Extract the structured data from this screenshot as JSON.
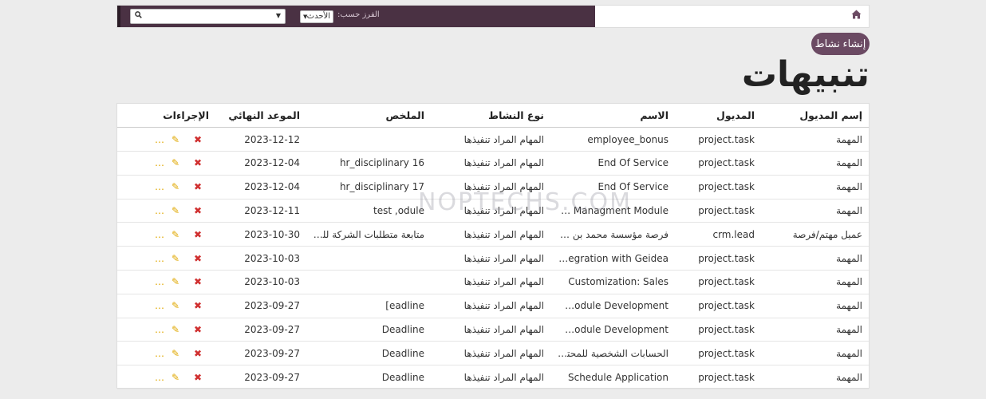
{
  "topbar": {
    "sort_label": "الفرز حسب:",
    "sort_value": "الأحدث",
    "search_placeholder": ""
  },
  "create_button": "إنشاء نشاط",
  "page_title": "تنبيهات",
  "watermark": "NOPTECHS.COM",
  "table": {
    "headers": {
      "model_name": "إسم المديول",
      "module": "المديول",
      "name": "الاسم",
      "activity_type": "نوع النشاط",
      "summary": "الملخص",
      "deadline": "الموعد النهائي",
      "actions": "الإجراءات"
    },
    "rows": [
      {
        "model_name": "المهمة",
        "module": "project.task",
        "name": "employee_bonus",
        "activity_type": "المهام المراد تنفيذها",
        "summary": "",
        "deadline": "2023-12-12"
      },
      {
        "model_name": "المهمة",
        "module": "project.task",
        "name": "End Of Service",
        "activity_type": "المهام المراد تنفيذها",
        "summary": "hr_disciplinary 16",
        "deadline": "2023-12-04"
      },
      {
        "model_name": "المهمة",
        "module": "project.task",
        "name": "End Of Service",
        "activity_type": "المهام المراد تنفيذها",
        "summary": "hr_disciplinary 17",
        "deadline": "2023-12-04"
      },
      {
        "model_name": "المهمة",
        "module": "project.task",
        "name": "Loan Managment Module",
        "activity_type": "المهام المراد تنفيذها",
        "summary": "test ,odule",
        "deadline": "2023-12-11"
      },
      {
        "model_name": "عميل مهتم/فرصة",
        "module": "crm.lead",
        "name": "فرصة مؤسسة محمد بن عب...",
        "activity_type": "المهام المراد تنفيذها",
        "summary": "متابعة متطلبات الشركة للت...",
        "deadline": "2023-10-30"
      },
      {
        "model_name": "المهمة",
        "module": "project.task",
        "name": "integration with Geidea",
        "activity_type": "المهام المراد تنفيذها",
        "summary": "",
        "deadline": "2023-10-03"
      },
      {
        "model_name": "المهمة",
        "module": "project.task",
        "name": "Customization: Sales",
        "activity_type": "المهام المراد تنفيذها",
        "summary": "",
        "deadline": "2023-10-03"
      },
      {
        "model_name": "المهمة",
        "module": "project.task",
        "name": "ary Module Development",
        "activity_type": "المهام المراد تنفيذها",
        "summary": "eadline]",
        "deadline": "2023-09-27"
      },
      {
        "model_name": "المهمة",
        "module": "project.task",
        "name": "ion Module Development",
        "activity_type": "المهام المراد تنفيذها",
        "summary": "Deadline",
        "deadline": "2023-09-27"
      },
      {
        "model_name": "المهمة",
        "module": "project.task",
        "name": "الحسابات الشخصية للمحتاج...",
        "activity_type": "المهام المراد تنفيذها",
        "summary": "Deadline",
        "deadline": "2023-09-27"
      },
      {
        "model_name": "المهمة",
        "module": "project.task",
        "name": "Schedule Application",
        "activity_type": "المهام المراد تنفيذها",
        "summary": "Deadline",
        "deadline": "2023-09-27"
      }
    ]
  },
  "icons": {
    "home": "home-icon",
    "search": "search-icon",
    "done": "check-icon",
    "edit": "pencil-icon",
    "delete": "close-icon"
  },
  "colors": {
    "topbar": "#4a3143",
    "button": "#6b4a63",
    "done": "#1e8a3c",
    "edit": "#e0a800",
    "delete": "#d03030"
  }
}
